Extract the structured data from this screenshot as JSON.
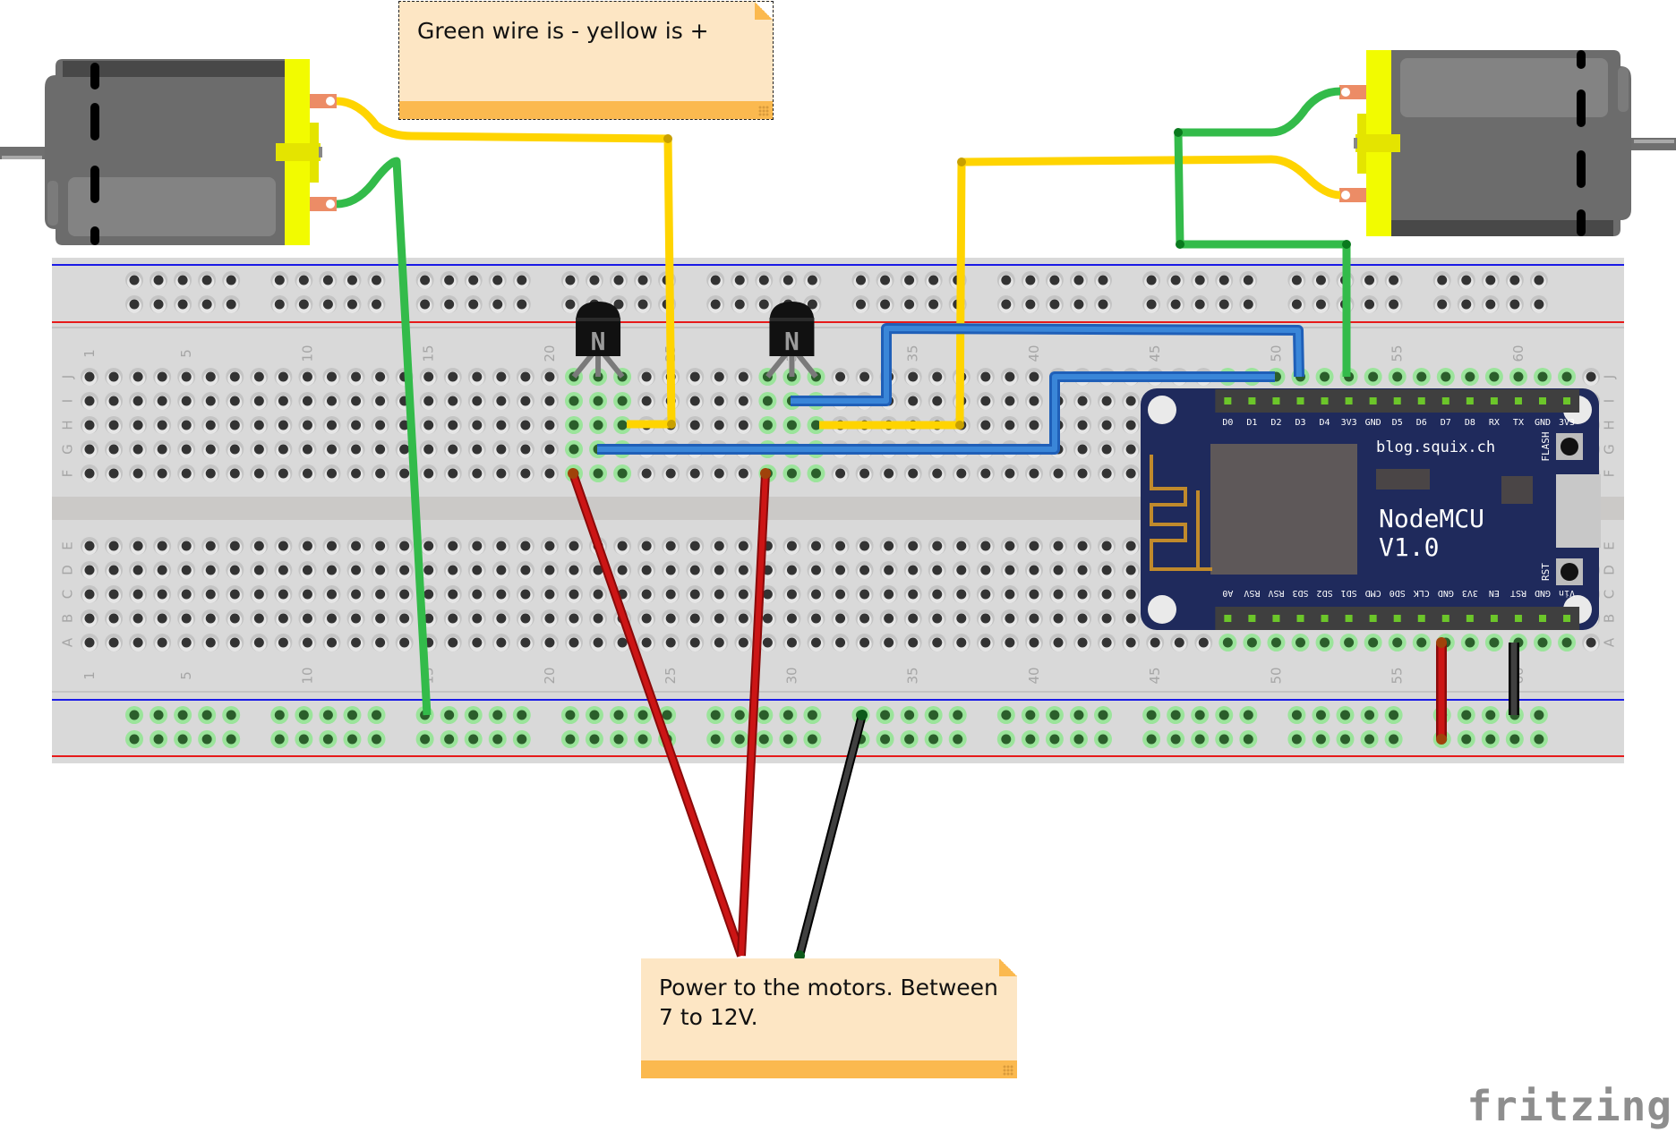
{
  "app": "fritzing",
  "logo_text": "fritzing",
  "notes": [
    {
      "id": "polarity-note",
      "text": "Green wire is - yellow is +"
    },
    {
      "id": "power-note",
      "text": "Power to the motors. Between\n7 to 12V."
    }
  ],
  "breadboard": {
    "columns": 63,
    "column_labels": [
      "1",
      "5",
      "10",
      "15",
      "20",
      "25",
      "30",
      "35",
      "40",
      "45",
      "50",
      "55",
      "60"
    ],
    "top_rows": [
      "J",
      "I",
      "H",
      "G",
      "F"
    ],
    "bottom_rows": [
      "E",
      "D",
      "C",
      "B",
      "A"
    ]
  },
  "components": {
    "transistors": [
      {
        "label": "N",
        "type": "NPN transistor",
        "column": 21
      },
      {
        "label": "N",
        "type": "NPN transistor",
        "column": 29
      }
    ],
    "motors": [
      {
        "name": "DC motor left"
      },
      {
        "name": "DC motor right"
      }
    ],
    "nodemcu": {
      "title_line1": "NodeMCU",
      "title_line2": "V1.0",
      "url": "blog.squix.ch",
      "button_flash": "FLASH",
      "button_rst": "RST",
      "top_pins": [
        "D0",
        "D1",
        "D2",
        "D3",
        "D4",
        "3V3",
        "GND",
        "D5",
        "D6",
        "D7",
        "D8",
        "RX",
        "TX",
        "GND",
        "3V3"
      ],
      "bottom_pins": [
        "A0",
        "RSV",
        "RSV",
        "SD3",
        "SD2",
        "SD1",
        "CMD",
        "SD0",
        "CLK",
        "GND",
        "3V3",
        "EN",
        "RST",
        "GND",
        "Vin"
      ]
    }
  },
  "colors": {
    "board": "#d9d9d9",
    "rail_blue": "#1a1ae6",
    "rail_red": "#e61a1a",
    "wire_yellow": "#ffd400",
    "wire_green": "#33bb4a",
    "wire_blue": "#3a86d8",
    "wire_red": "#cc1515",
    "wire_black": "#404040",
    "pcb": "#1f2a5c",
    "motor_body": "#6c6c6c",
    "motor_cap": "#f2fb00",
    "note_bg": "#fde6c4",
    "note_bar": "#fbb94f"
  }
}
